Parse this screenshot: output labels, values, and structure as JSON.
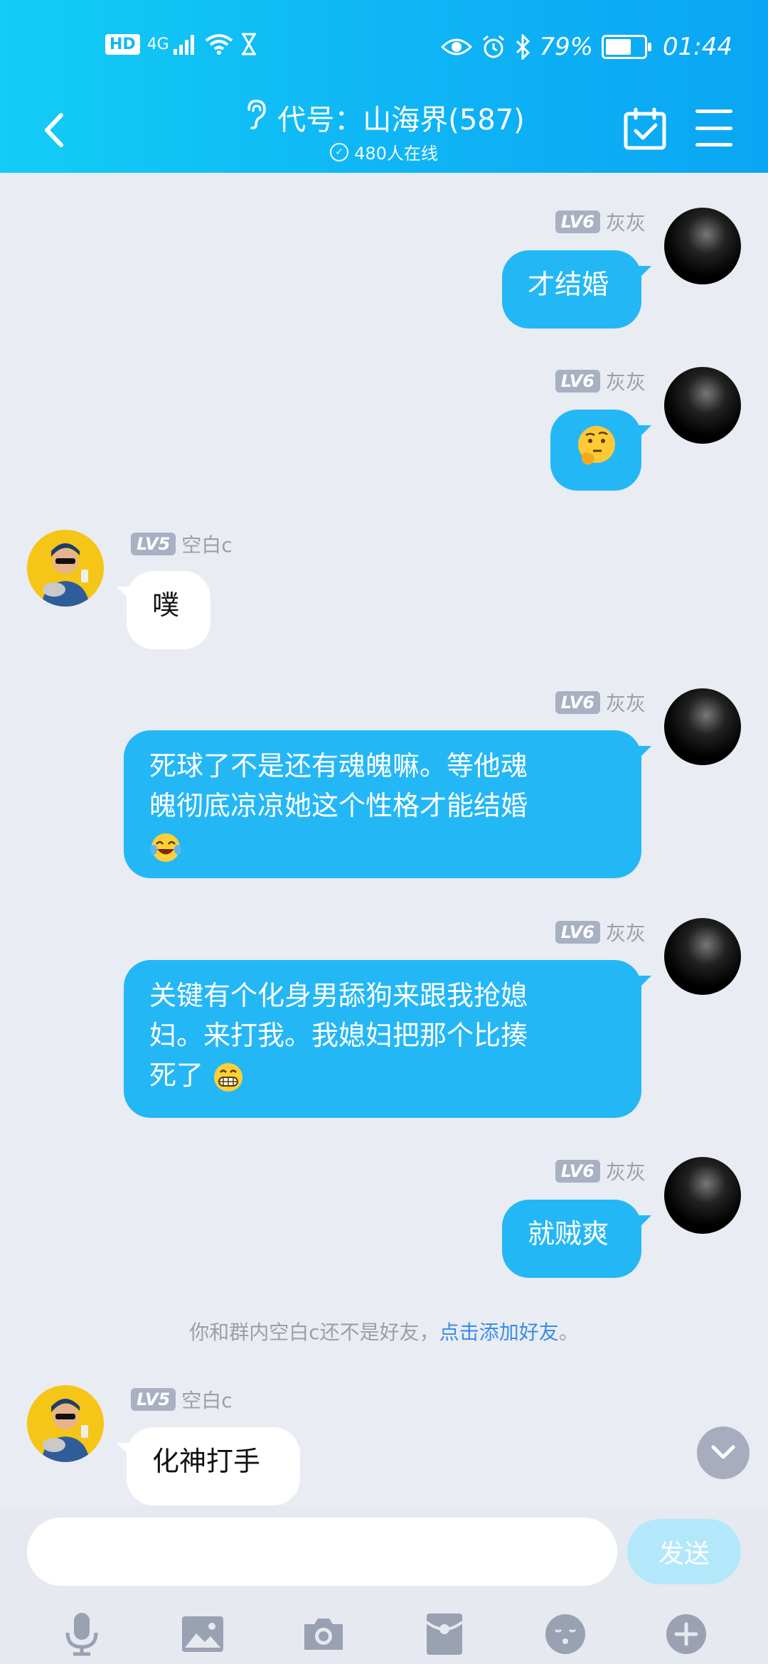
{
  "status_bar": {
    "hd": "HD",
    "network": "4G",
    "battery_text": "79%",
    "battery_level": 0.79,
    "time": "01:44"
  },
  "header": {
    "title": "代号：山海界(587)",
    "online": "480人在线"
  },
  "messages": [
    {
      "sender": "灰灰",
      "level": "LV6",
      "side": "me",
      "text": "才结婚"
    },
    {
      "sender": "灰灰",
      "level": "LV6",
      "side": "me",
      "text": "",
      "emoji": "thinking-face-emoji"
    },
    {
      "sender": "空白c",
      "level": "LV5",
      "side": "other",
      "text": "噗"
    },
    {
      "sender": "灰灰",
      "level": "LV6",
      "side": "me",
      "line1": "死球了不是还有魂魄嘛。等他魂",
      "line2": "魄彻底凉凉她这个性格才能结婚",
      "emoji": "laughing-tears-emoji"
    },
    {
      "sender": "灰灰",
      "level": "LV6",
      "side": "me",
      "line1": "关键有个化身男舔狗来跟我抢媳",
      "line2": "妇。来打我。我媳妇把那个比揍",
      "line3": "死了",
      "emoji": "grinning-face-emoji"
    },
    {
      "sender": "灰灰",
      "level": "LV6",
      "side": "me",
      "text": "就贼爽"
    },
    {
      "sender": "空白c",
      "level": "LV5",
      "side": "other",
      "text": "化神打手"
    }
  ],
  "system_note": {
    "text": "你和群内空白c还不是好友，",
    "link": "点击添加好友",
    "suffix": "。"
  },
  "input": {
    "value": "",
    "send_label": "发送"
  },
  "toolbar_icons": [
    "microphone-icon",
    "image-icon",
    "camera-icon",
    "red-packet-icon",
    "emoji-icon",
    "plus-icon"
  ]
}
